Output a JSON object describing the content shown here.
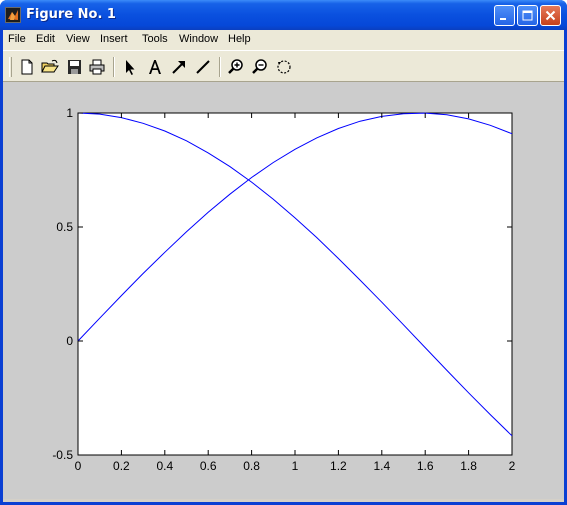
{
  "window": {
    "title": "Figure No. 1"
  },
  "menu": [
    "File",
    "Edit",
    "View",
    "Insert",
    "Tools",
    "Window",
    "Help"
  ],
  "toolbar_icons": [
    "new-figure-icon",
    "open-file-icon",
    "save-icon",
    "print-icon",
    "select-arrow-icon",
    "insert-text-icon",
    "insert-arrow-icon",
    "insert-line-icon",
    "zoom-in-icon",
    "zoom-out-icon",
    "rotate-icon"
  ],
  "colors": {
    "series": "#0000ff",
    "plot_bg": "#ffffff",
    "figure_bg": "#cccccc",
    "title_bar": "#0a50df"
  },
  "chart_data": {
    "type": "line",
    "title": "",
    "xlabel": "",
    "ylabel": "",
    "xlim": [
      0,
      2
    ],
    "ylim": [
      -0.5,
      1
    ],
    "grid": false,
    "x_ticks": [
      "0",
      "0.2",
      "0.4",
      "0.6",
      "0.8",
      "1",
      "1.2",
      "1.4",
      "1.6",
      "1.8",
      "2"
    ],
    "y_ticks": [
      "-0.5",
      "0",
      "0.5",
      "1"
    ],
    "series": [
      {
        "color": "#0000ff",
        "x": [
          0,
          0.1,
          0.2,
          0.3,
          0.4,
          0.5,
          0.6,
          0.7,
          0.8,
          0.9,
          1.0,
          1.1,
          1.2,
          1.3,
          1.4,
          1.5,
          1.6,
          1.7,
          1.8,
          1.9,
          2.0
        ],
        "y": [
          1.0,
          0.995,
          0.98,
          0.955,
          0.921,
          0.878,
          0.825,
          0.765,
          0.697,
          0.622,
          0.54,
          0.454,
          0.362,
          0.267,
          0.17,
          0.071,
          -0.029,
          -0.129,
          -0.227,
          -0.323,
          -0.416
        ]
      },
      {
        "color": "#0000ff",
        "x": [
          0,
          0.1,
          0.2,
          0.3,
          0.4,
          0.5,
          0.6,
          0.7,
          0.8,
          0.9,
          1.0,
          1.1,
          1.2,
          1.3,
          1.4,
          1.5,
          1.6,
          1.7,
          1.8,
          1.9,
          2.0
        ],
        "y": [
          0.0,
          0.1,
          0.199,
          0.296,
          0.389,
          0.479,
          0.565,
          0.644,
          0.717,
          0.783,
          0.841,
          0.891,
          0.932,
          0.964,
          0.985,
          0.997,
          0.9996,
          0.992,
          0.974,
          0.946,
          0.909
        ]
      }
    ]
  }
}
